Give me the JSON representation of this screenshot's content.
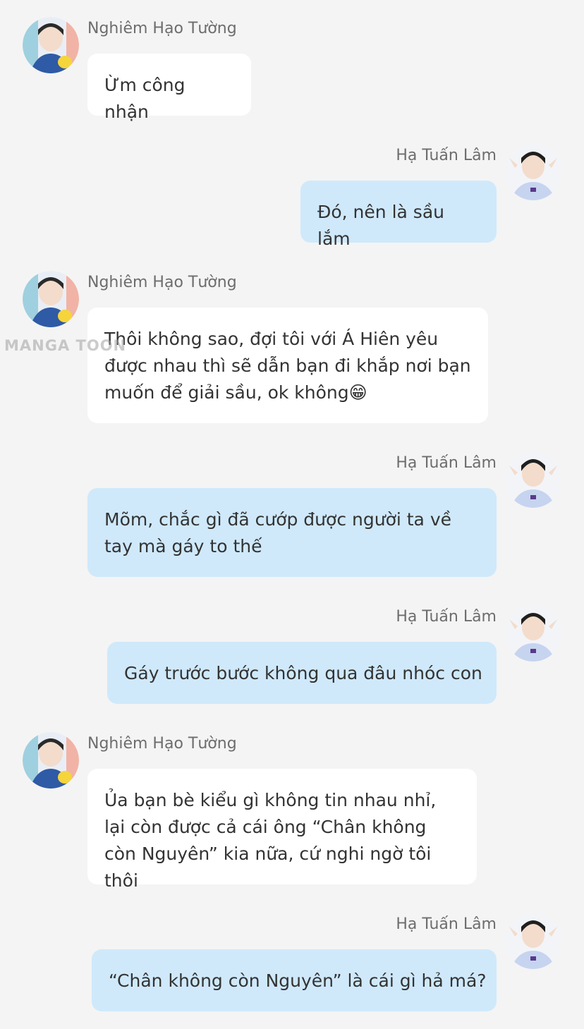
{
  "watermark": "MANGA TOON",
  "messages": [
    {
      "side": "left",
      "sender": "Nghiêm Hạo Tường",
      "text": "Ừm công nhận"
    },
    {
      "side": "right",
      "sender": "Hạ Tuấn Lâm",
      "text": "Đó, nên là sầu lắm"
    },
    {
      "side": "left",
      "sender": "Nghiêm Hạo Tường",
      "text": "Thôi không sao, đợi tôi với Á Hiên yêu được nhau thì sẽ dẫn bạn đi khắp nơi bạn muốn để giải sầu, ok không😁"
    },
    {
      "side": "right",
      "sender": "Hạ Tuấn Lâm",
      "text": "Mõm, chắc gì đã cướp được người ta về tay mà gáy to thế"
    },
    {
      "side": "right",
      "sender": "Hạ Tuấn Lâm",
      "text": "Gáy trước bước không qua đâu nhóc con"
    },
    {
      "side": "left",
      "sender": "Nghiêm Hạo Tường",
      "text": "Ủa bạn bè kiểu gì không tin nhau nhỉ, lại còn được cả cái ông “Chân không còn Nguyên” kia nữa, cứ nghi ngờ tôi thôi"
    },
    {
      "side": "right",
      "sender": "Hạ Tuấn Lâm",
      "text": "“Chân không còn Nguyên” là cái gì hả má?"
    }
  ]
}
